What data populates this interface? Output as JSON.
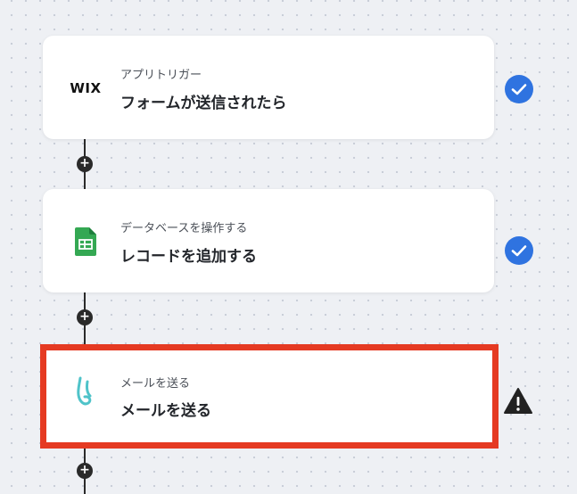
{
  "steps": [
    {
      "subtitle": "アプリトリガー",
      "title": "フォームが送信されたら",
      "app": "WIX",
      "icon": "wix-logo",
      "status": "complete"
    },
    {
      "subtitle": "データベースを操作する",
      "title": "レコードを追加する",
      "icon": "google-sheets-icon",
      "status": "complete"
    },
    {
      "subtitle": "メールを送る",
      "title": "メールを送る",
      "icon": "mail-send-icon",
      "status": "warning"
    }
  ],
  "colors": {
    "check": "#2f73e0",
    "warning": "#222222",
    "highlight": "#e53a22",
    "sheets": "#34a853"
  },
  "add_step_label": "+"
}
